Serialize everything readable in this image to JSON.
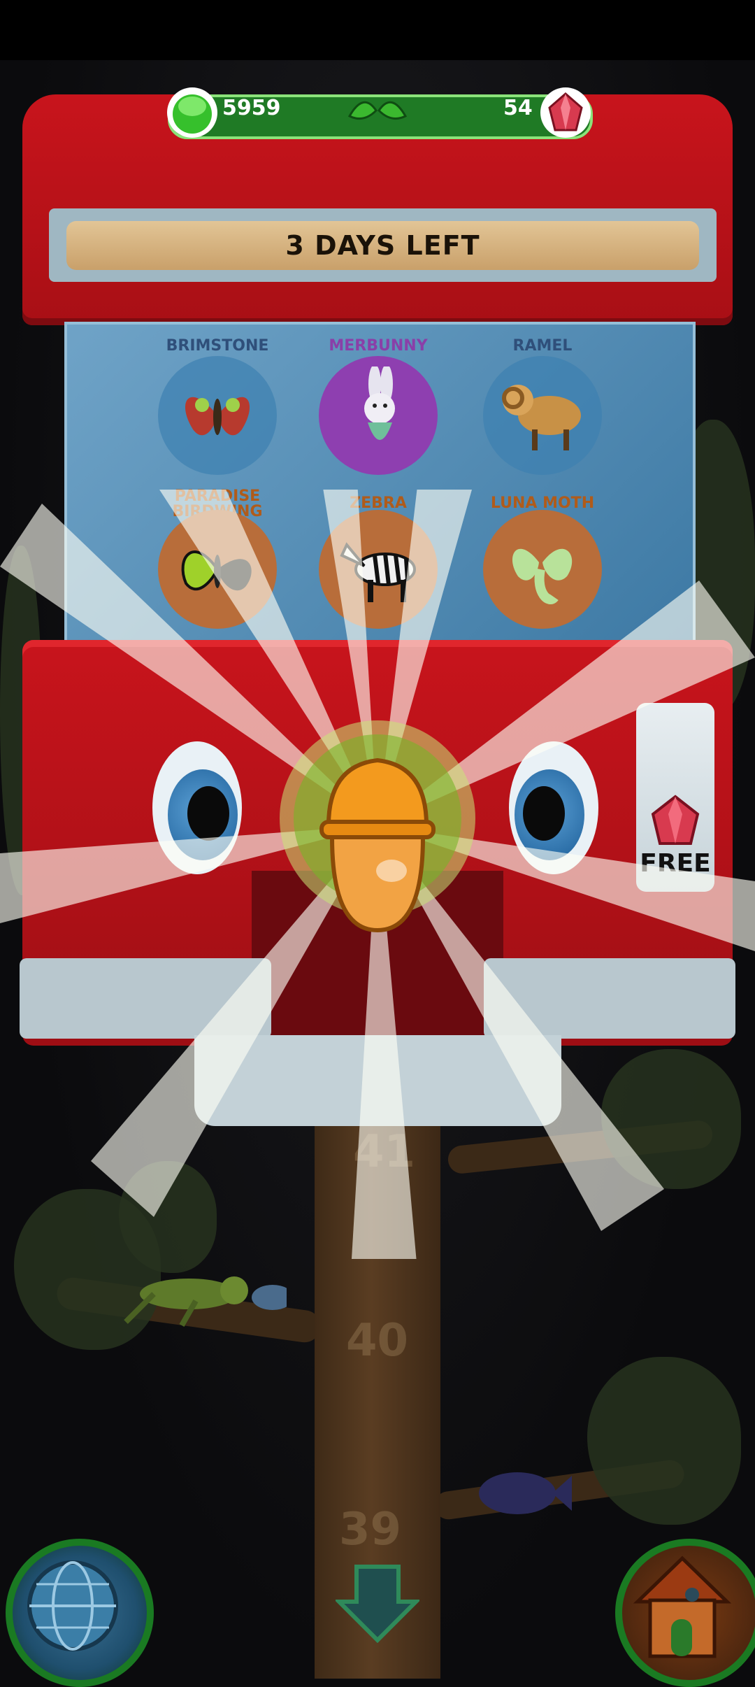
{
  "header": {
    "left_currency": {
      "icon": "green-gumball-icon",
      "value": "5959"
    },
    "right_currency": {
      "icon": "red-gem-icon",
      "value": "54"
    },
    "center_icon": "leaf-ornament-icon"
  },
  "machine": {
    "banner_text": "3 DAYS LEFT",
    "creatures": [
      {
        "label": "BRIMSTONE",
        "icon": "butterfly-icon",
        "tier": "common",
        "color": "#3d80b0"
      },
      {
        "label": "MERBUNNY",
        "icon": "merbunny-icon",
        "tier": "rare",
        "color": "#8e3fb0"
      },
      {
        "label": "RAMEL",
        "icon": "ramel-icon",
        "tier": "common",
        "color": "#3d80b0"
      },
      {
        "label": "PARADISE BIRDWING",
        "icon": "birdwing-icon",
        "tier": "uncommon",
        "color": "#b86d3a"
      },
      {
        "label": "ZEBRA",
        "icon": "zebra-icon",
        "tier": "uncommon",
        "color": "#b86d3a"
      },
      {
        "label": "LUNA MOTH",
        "icon": "luna-moth-icon",
        "tier": "uncommon",
        "color": "#b86d3a"
      }
    ],
    "free_button": {
      "icon": "red-gem-icon",
      "label": "FREE"
    },
    "capsule": {
      "icon": "orange-capsule-icon",
      "color": "#f39a1e"
    }
  },
  "tree": {
    "numbers": [
      "41",
      "40",
      "39"
    ]
  },
  "bottom_nav": {
    "left": "globe-icon",
    "center": "down-arrow-icon",
    "right": "birdhouse-icon"
  },
  "colors": {
    "machine_red": "#c8141c",
    "accent_green": "#1f7a25"
  }
}
